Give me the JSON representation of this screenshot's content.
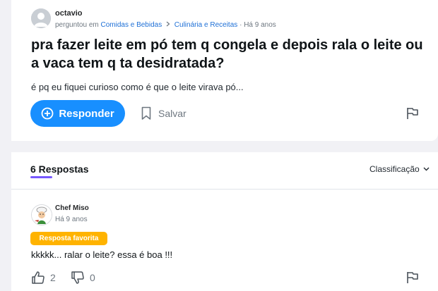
{
  "question": {
    "author": "octavio",
    "meta": {
      "asked_label": "perguntou em",
      "category": "Comidas e Bebidas",
      "subcategory": "Culinária e Receitas",
      "time_sep": "·",
      "time": "Há 9 anos"
    },
    "title": "pra fazer leite em pó tem q congela e depois rala o leite ou a vaca tem q ta desidratada?",
    "detail": "é pq eu fiquei curioso como é que o leite virava pó...",
    "actions": {
      "answer_label": "Responder",
      "save_label": "Salvar"
    }
  },
  "answers_header": {
    "count_label": "6 Respostas",
    "sort_label": "Classificação"
  },
  "answers": [
    {
      "author": "Chef Miso",
      "time": "Há 9 anos",
      "badge": "Resposta favorita",
      "text": "kkkkk... ralar o leite? essa é boa !!!",
      "upvotes": "2",
      "downvotes": "0"
    }
  ],
  "colors": {
    "primary": "#188fff",
    "link": "#1d6fd6",
    "badge": "#ffb300",
    "tab_underline": "#7759ff",
    "background": "#f1f1f5"
  },
  "icons": [
    "user-avatar-icon",
    "chevron-right-icon",
    "plus-circle-icon",
    "bookmark-icon",
    "flag-icon",
    "chevron-down-icon",
    "thumbs-up-icon",
    "thumbs-down-icon",
    "chef-avatar-icon"
  ]
}
